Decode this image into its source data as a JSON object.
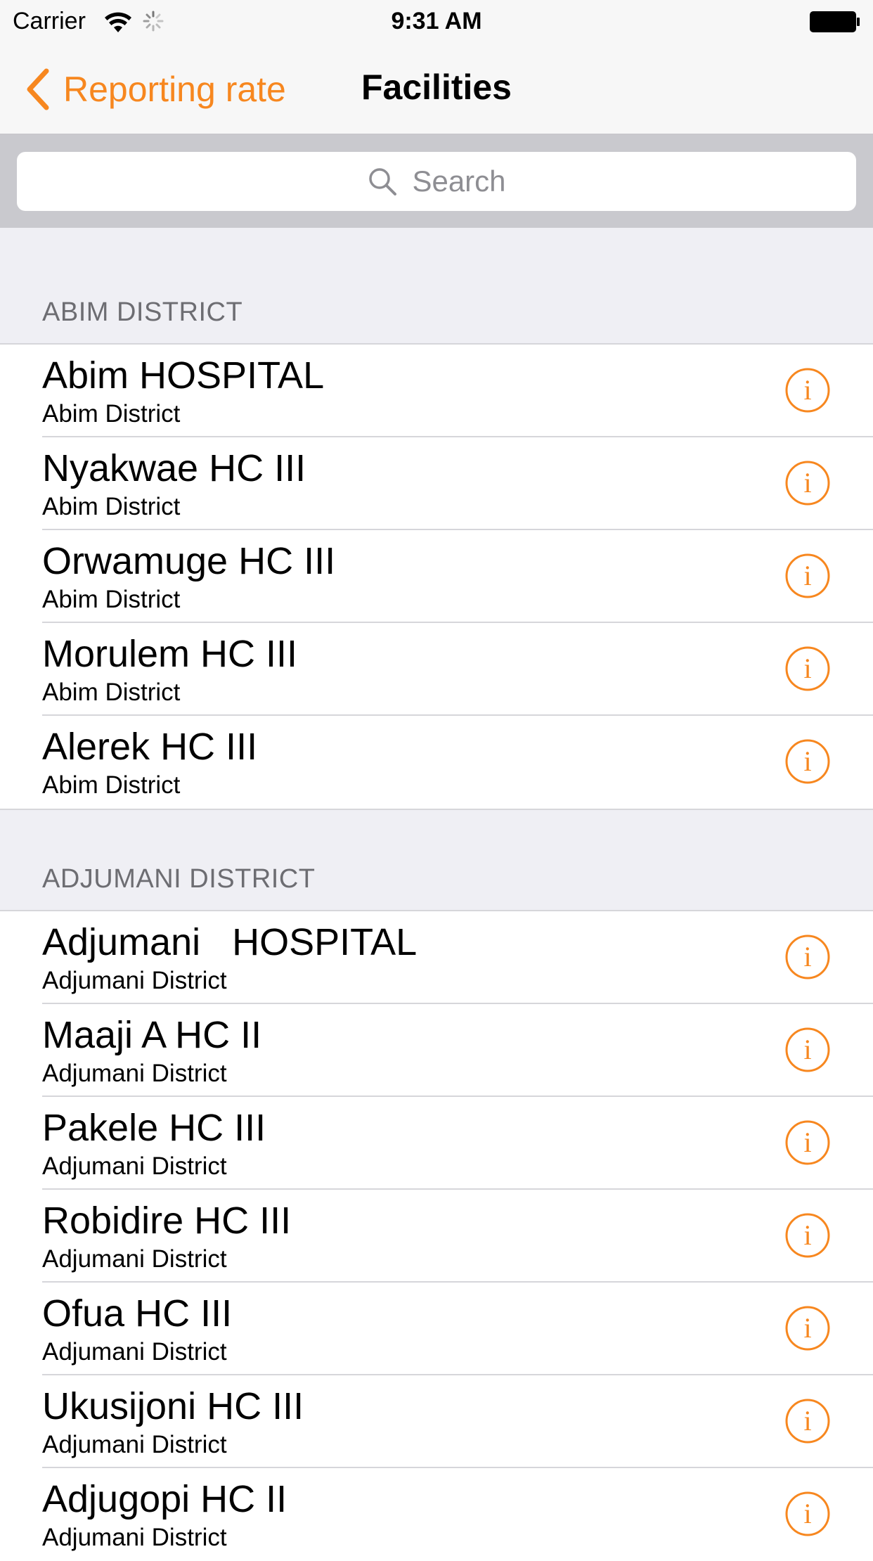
{
  "status_bar": {
    "carrier": "Carrier",
    "time": "9:31 AM"
  },
  "nav": {
    "back_label": "Reporting rate",
    "title": "Facilities"
  },
  "search": {
    "placeholder": "Search"
  },
  "colors": {
    "accent": "#f7871f",
    "section_bg": "#efeff4",
    "search_bar_bg": "#c9c9ce"
  },
  "sections": [
    {
      "header": "ABIM DISTRICT",
      "rows": [
        {
          "name": "Abim HOSPITAL",
          "district": "Abim District"
        },
        {
          "name": "Nyakwae HC III",
          "district": "Abim District"
        },
        {
          "name": "Orwamuge HC III",
          "district": "Abim District"
        },
        {
          "name": "Morulem HC III",
          "district": "Abim District"
        },
        {
          "name": "Alerek HC III",
          "district": "Abim District"
        }
      ]
    },
    {
      "header": "ADJUMANI DISTRICT",
      "rows": [
        {
          "name": "Adjumani   HOSPITAL",
          "district": "Adjumani District"
        },
        {
          "name": "Maaji A HC II",
          "district": "Adjumani District"
        },
        {
          "name": "Pakele HC III",
          "district": "Adjumani District"
        },
        {
          "name": "Robidire HC III",
          "district": "Adjumani District"
        },
        {
          "name": "Ofua HC III",
          "district": "Adjumani District"
        },
        {
          "name": "Ukusijoni HC III",
          "district": "Adjumani District"
        },
        {
          "name": "Adjugopi HC II",
          "district": "Adjumani District"
        }
      ]
    }
  ]
}
